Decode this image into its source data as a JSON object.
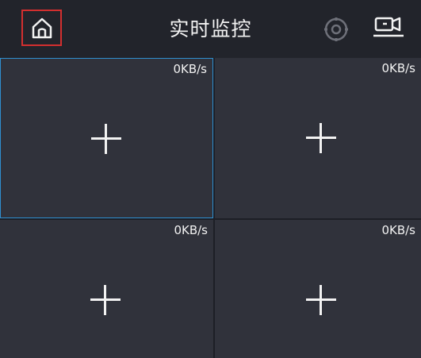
{
  "header": {
    "title": "实时监控",
    "icons": {
      "home": "home-icon",
      "settings": "gear-icon",
      "camera": "camera-device-icon"
    }
  },
  "channels": [
    {
      "rate": "0KB/s",
      "selected": true
    },
    {
      "rate": "0KB/s",
      "selected": false
    },
    {
      "rate": "0KB/s",
      "selected": false
    },
    {
      "rate": "0KB/s",
      "selected": false
    }
  ],
  "colors": {
    "background": "#1d1f26",
    "header": "#22242b",
    "cell": "#30323b",
    "selected_border": "#2f8fd0",
    "home_highlight": "#d32f2f",
    "text": "#f2f2f2"
  }
}
